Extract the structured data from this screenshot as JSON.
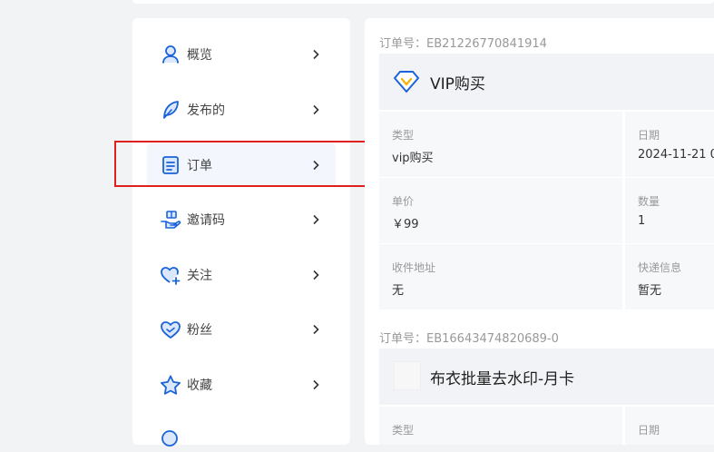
{
  "sidebar": {
    "items": [
      {
        "label": "概览",
        "icon": "user-icon"
      },
      {
        "label": "发布的",
        "icon": "feather-icon"
      },
      {
        "label": "订单",
        "icon": "order-icon"
      },
      {
        "label": "邀请码",
        "icon": "hand-gift-icon"
      },
      {
        "label": "关注",
        "icon": "heart-plus-icon"
      },
      {
        "label": "粉丝",
        "icon": "heart-icon"
      },
      {
        "label": "收藏",
        "icon": "star-icon"
      }
    ],
    "active_index": 2
  },
  "orders": [
    {
      "order_no": "订单号：EB21226770841914",
      "title": "VIP购买",
      "icon": "vip-diamond-icon",
      "fields": {
        "type_label": "类型",
        "type_value": "vip购买",
        "date_label": "日期",
        "date_value": "2024-11-21 0",
        "price_label": "单价",
        "price_value": "￥99",
        "qty_label": "数量",
        "qty_value": "1",
        "addr_label": "收件地址",
        "addr_value": "无",
        "ship_label": "快递信息",
        "ship_value": "暂无"
      }
    },
    {
      "order_no": "订单号：EB16643474820689-0",
      "title": "布衣批量去水印-月卡",
      "icon": "product-thumbnail",
      "fields": {
        "type_label": "类型",
        "date_label": "日期"
      }
    }
  ],
  "colors": {
    "accent": "#1a63d8",
    "highlight_border": "#e0201c",
    "vip_icon": "#f5b400"
  }
}
